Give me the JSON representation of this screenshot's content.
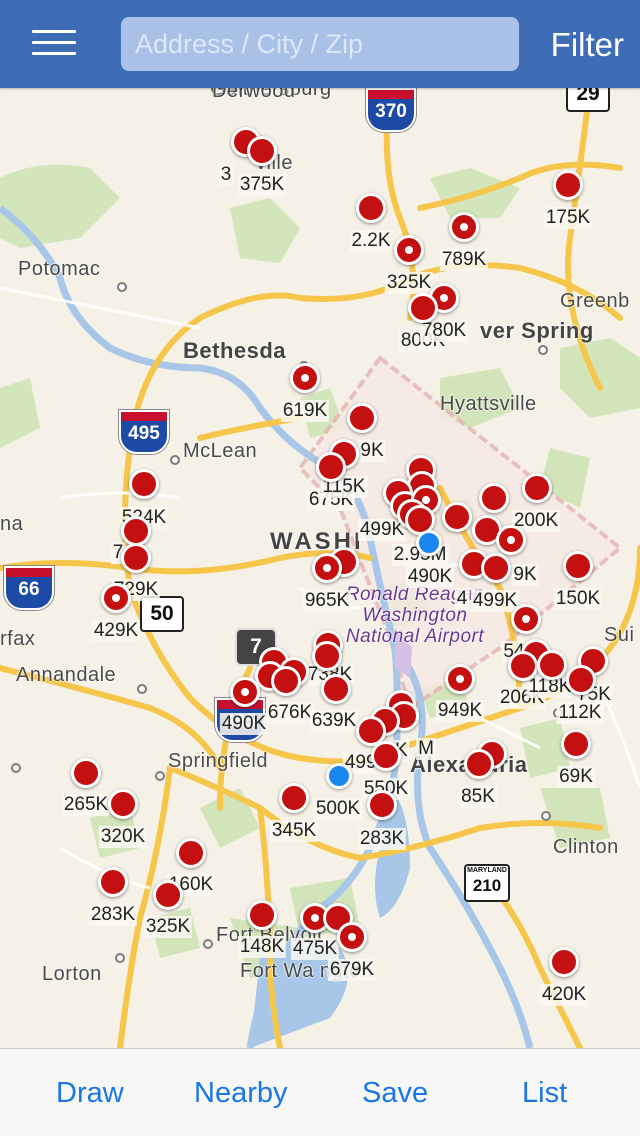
{
  "header": {
    "search_placeholder": "Address / City / Zip",
    "filter_label": "Filter"
  },
  "map": {
    "place_labels": [
      {
        "name": "Gaithersburg",
        "cls": ""
      },
      {
        "name": "Derwood",
        "cls": ""
      },
      {
        "name": "Potomac",
        "cls": ""
      },
      {
        "name": "Bethesda",
        "cls": "big"
      },
      {
        "name": "McLean",
        "cls": ""
      },
      {
        "name": "Hyattsville",
        "cls": ""
      },
      {
        "name": "Greenb",
        "cls": ""
      },
      {
        "name": "ver Spring",
        "cls": "big"
      },
      {
        "name": "WASHI",
        "cls": "dc"
      },
      {
        "name": "na",
        "cls": ""
      },
      {
        "name": "rfax",
        "cls": ""
      },
      {
        "name": "Annandale",
        "cls": ""
      },
      {
        "name": "Springfield",
        "cls": ""
      },
      {
        "name": "Alexandria",
        "cls": "big"
      },
      {
        "name": "Clinton",
        "cls": ""
      },
      {
        "name": "Lorton",
        "cls": ""
      },
      {
        "name": "Fort Belvoir",
        "cls": ""
      },
      {
        "name": "Fort Wa   ngton",
        "cls": ""
      },
      {
        "name": "Sui",
        "cls": ""
      },
      {
        "name": "ville",
        "cls": ""
      },
      {
        "name": "Ronald Reagan Washington National Airport",
        "cls": "airport"
      }
    ],
    "shields": [
      "370",
      "29",
      "495",
      "66",
      "50",
      "7",
      "495",
      "210"
    ],
    "price_labels": [
      "375K",
      "3",
      "175K",
      "2.2K",
      "789K",
      "325K",
      "800K",
      "780K",
      "619K",
      "9K",
      "675K",
      "115K",
      "524K",
      "7",
      "729K",
      "429K",
      "965K",
      "2.95M",
      "490K",
      "499K",
      "9K",
      "200K",
      "150K",
      "4",
      "499K",
      "54",
      "206K",
      "118K",
      "75K",
      "112K",
      "949K",
      "490K",
      "676K",
      "639K",
      "738K",
      "499K",
      "8K",
      "M",
      "550K",
      "85K",
      "69K",
      "265K",
      "320K",
      "500K",
      "345K",
      "283K",
      "160K",
      "283K",
      "325K",
      "148K",
      "475K",
      "679K",
      "420K"
    ]
  },
  "toolbar": {
    "draw": "Draw",
    "nearby": "Nearby",
    "save": "Save",
    "list": "List"
  },
  "colors": {
    "header_bg": "#3e6db6",
    "pin": "#c41010",
    "location_dot": "#1a86f0",
    "toolbar_text": "#1a75e6"
  },
  "icons": [
    "hamburger-menu-icon",
    "property-pin-icon",
    "location-dot-icon"
  ]
}
